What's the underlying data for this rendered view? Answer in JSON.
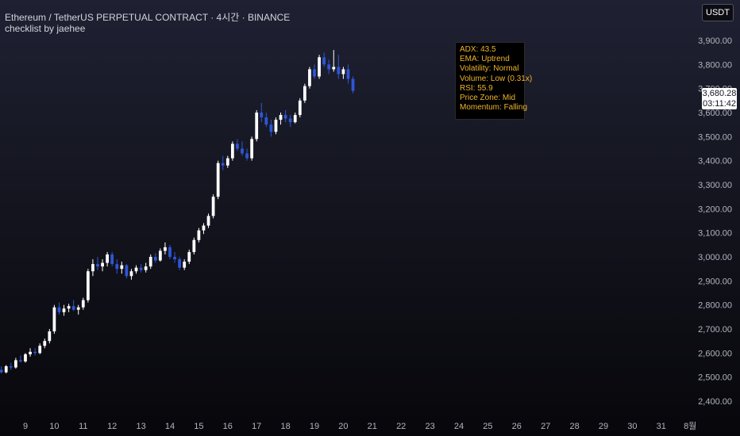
{
  "header": {
    "title": "Ethereum / TetherUS PERPETUAL CONTRACT · 4시간 · BINANCE",
    "subtitle": "checklist by jaehee"
  },
  "currency_button": "USDT",
  "info_box": {
    "lines": [
      "ADX: 43.5",
      "EMA: Uptrend",
      "Volatility: Normal",
      "Volume: Low (0.31x)",
      "RSI: 55.9",
      "Price Zone: Mid",
      "Momentum: Falling"
    ]
  },
  "last_price": {
    "price": "3,680.28",
    "countdown": "03:11:42"
  },
  "colors": {
    "up": "#ffffff",
    "down": "#2f56d6",
    "info_text": "#f0b429",
    "axis_text": "#b2b5be"
  },
  "chart_data": {
    "type": "candlestick",
    "y_ticks": [
      "3,900.00",
      "3,800.00",
      "3,700.00",
      "3,600.00",
      "3,500.00",
      "3,400.00",
      "3,300.00",
      "3,200.00",
      "3,100.00",
      "3,000.00",
      "2,900.00",
      "2,800.00",
      "2,700.00",
      "2,600.00",
      "2,500.00",
      "2,400.00"
    ],
    "y_tick_values": [
      3900,
      3800,
      3700,
      3600,
      3500,
      3400,
      3300,
      3200,
      3100,
      3000,
      2900,
      2800,
      2700,
      2600,
      2500,
      2400
    ],
    "x_ticks": [
      "9",
      "10",
      "11",
      "12",
      "13",
      "14",
      "15",
      "16",
      "17",
      "18",
      "19",
      "20",
      "21",
      "22",
      "23",
      "24",
      "25",
      "26",
      "27",
      "28",
      "29",
      "30",
      "31",
      "8월"
    ],
    "ylim": [
      2370,
      3950
    ],
    "x_start_day": 8,
    "candles_per_day": 6,
    "candles": [
      [
        2520,
        2540,
        2510,
        2530
      ],
      [
        2530,
        2545,
        2515,
        2520
      ],
      [
        2520,
        2550,
        2515,
        2545
      ],
      [
        2545,
        2560,
        2530,
        2540
      ],
      [
        2540,
        2580,
        2535,
        2570
      ],
      [
        2570,
        2590,
        2560,
        2565
      ],
      [
        2565,
        2600,
        2560,
        2595
      ],
      [
        2595,
        2620,
        2585,
        2605
      ],
      [
        2605,
        2620,
        2590,
        2600
      ],
      [
        2600,
        2640,
        2595,
        2630
      ],
      [
        2630,
        2660,
        2620,
        2650
      ],
      [
        2650,
        2700,
        2640,
        2690
      ],
      [
        2690,
        2800,
        2680,
        2790
      ],
      [
        2790,
        2810,
        2760,
        2770
      ],
      [
        2770,
        2800,
        2755,
        2785
      ],
      [
        2785,
        2805,
        2770,
        2795
      ],
      [
        2795,
        2820,
        2775,
        2780
      ],
      [
        2780,
        2800,
        2760,
        2790
      ],
      [
        2790,
        2830,
        2780,
        2820
      ],
      [
        2820,
        2950,
        2810,
        2940
      ],
      [
        2940,
        2990,
        2920,
        2970
      ],
      [
        2970,
        3000,
        2945,
        2960
      ],
      [
        2960,
        2990,
        2940,
        2975
      ],
      [
        2975,
        3020,
        2960,
        3010
      ],
      [
        3010,
        3020,
        2960,
        2970
      ],
      [
        2970,
        2990,
        2930,
        2950
      ],
      [
        2950,
        2980,
        2930,
        2965
      ],
      [
        2965,
        2970,
        2910,
        2920
      ],
      [
        2920,
        2950,
        2905,
        2940
      ],
      [
        2940,
        2965,
        2930,
        2955
      ],
      [
        2955,
        2970,
        2935,
        2945
      ],
      [
        2945,
        2975,
        2935,
        2960
      ],
      [
        2960,
        3010,
        2950,
        3000
      ],
      [
        3000,
        3015,
        2975,
        2985
      ],
      [
        2985,
        3035,
        2980,
        3025
      ],
      [
        3025,
        3060,
        3010,
        3040
      ],
      [
        3040,
        3050,
        2990,
        3000
      ],
      [
        3000,
        3020,
        2975,
        2990
      ],
      [
        2990,
        3000,
        2945,
        2955
      ],
      [
        2955,
        2990,
        2945,
        2980
      ],
      [
        2980,
        3030,
        2970,
        3020
      ],
      [
        3020,
        3080,
        3010,
        3070
      ],
      [
        3070,
        3120,
        3060,
        3110
      ],
      [
        3110,
        3140,
        3095,
        3130
      ],
      [
        3130,
        3180,
        3120,
        3170
      ],
      [
        3170,
        3260,
        3160,
        3250
      ],
      [
        3250,
        3400,
        3240,
        3390
      ],
      [
        3390,
        3420,
        3360,
        3380
      ],
      [
        3380,
        3420,
        3370,
        3410
      ],
      [
        3410,
        3480,
        3400,
        3470
      ],
      [
        3470,
        3490,
        3440,
        3450
      ],
      [
        3450,
        3480,
        3420,
        3430
      ],
      [
        3430,
        3450,
        3400,
        3410
      ],
      [
        3410,
        3500,
        3400,
        3490
      ],
      [
        3490,
        3610,
        3480,
        3600
      ],
      [
        3600,
        3640,
        3560,
        3580
      ],
      [
        3580,
        3600,
        3540,
        3550
      ],
      [
        3550,
        3570,
        3500,
        3520
      ],
      [
        3520,
        3580,
        3510,
        3570
      ],
      [
        3570,
        3600,
        3550,
        3590
      ],
      [
        3590,
        3610,
        3560,
        3575
      ],
      [
        3575,
        3590,
        3540,
        3560
      ],
      [
        3560,
        3600,
        3555,
        3590
      ],
      [
        3590,
        3660,
        3580,
        3650
      ],
      [
        3650,
        3720,
        3640,
        3710
      ],
      [
        3710,
        3790,
        3700,
        3780
      ],
      [
        3780,
        3800,
        3740,
        3750
      ],
      [
        3750,
        3840,
        3740,
        3830
      ],
      [
        3830,
        3850,
        3790,
        3800
      ],
      [
        3800,
        3820,
        3760,
        3780
      ],
      [
        3780,
        3860,
        3770,
        3790
      ],
      [
        3790,
        3840,
        3740,
        3760
      ],
      [
        3760,
        3790,
        3740,
        3780
      ],
      [
        3780,
        3800,
        3720,
        3740
      ],
      [
        3740,
        3750,
        3680,
        3690
      ]
    ]
  }
}
